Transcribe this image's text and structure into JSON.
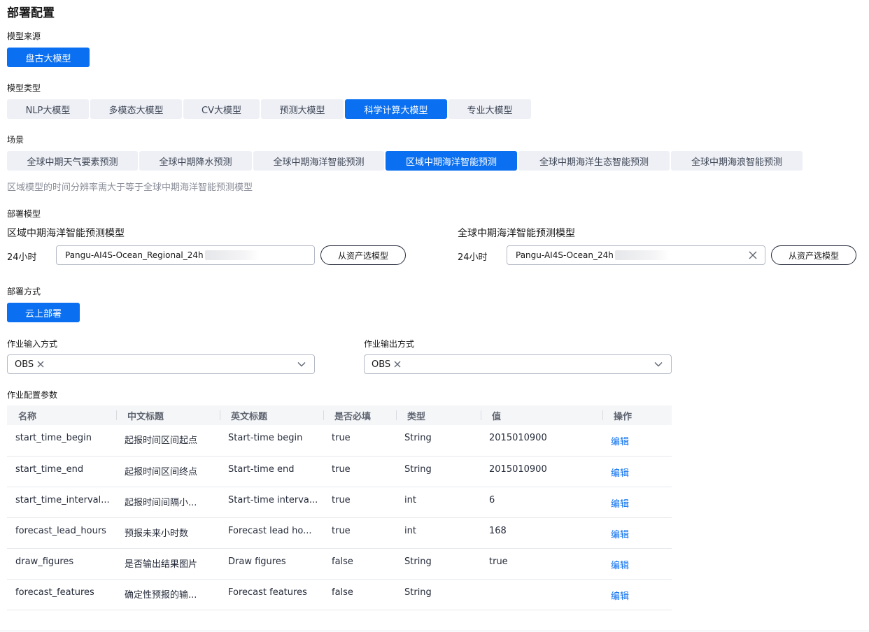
{
  "page_title": "部署配置",
  "model_source": {
    "label": "模型来源",
    "value": "盘古大模型"
  },
  "model_type": {
    "label": "模型类型",
    "tabs": [
      "NLP大模型",
      "多模态大模型",
      "CV大模型",
      "预测大模型",
      "科学计算大模型",
      "专业大模型"
    ],
    "active_index": 4
  },
  "scenario": {
    "label": "场景",
    "tabs": [
      "全球中期天气要素预测",
      "全球中期降水预测",
      "全球中期海洋智能预测",
      "区域中期海洋智能预测",
      "全球中期海洋生态智能预测",
      "全球中期海浪智能预测"
    ],
    "active_index": 3,
    "hint": "区域模型的时间分辨率需大于等于全球中期海洋智能预测模型"
  },
  "deploy_model": {
    "label": "部署模型",
    "regional": {
      "title": "区域中期海洋智能预测模型",
      "duration": "24小时",
      "value": "Pangu-AI4S-Ocean_Regional_24h",
      "button": "从资产选模型"
    },
    "global": {
      "title": "全球中期海洋智能预测模型",
      "duration": "24小时",
      "value": "Pangu-AI4S-Ocean_24h",
      "button": "从资产选模型"
    }
  },
  "deploy_method": {
    "label": "部署方式",
    "value": "云上部署"
  },
  "job_input": {
    "label": "作业输入方式",
    "value": "OBS"
  },
  "job_output": {
    "label": "作业输出方式",
    "value": "OBS"
  },
  "job_params": {
    "label": "作业配置参数",
    "columns": [
      "名称",
      "中文标题",
      "英文标题",
      "是否必填",
      "类型",
      "值",
      "操作"
    ],
    "rows": [
      {
        "name": "start_time_begin",
        "cn": "起报时间区间起点",
        "en": "Start-time begin",
        "required": "true",
        "type": "String",
        "value": "2015010900",
        "action": "编辑"
      },
      {
        "name": "start_time_end",
        "cn": "起报时间区间终点",
        "en": "Start-time end",
        "required": "true",
        "type": "String",
        "value": "2015010900",
        "action": "编辑"
      },
      {
        "name": "start_time_interval...",
        "cn": "起报时间间隔小...",
        "en": "Start-time interva...",
        "required": "true",
        "type": "int",
        "value": "6",
        "action": "编辑"
      },
      {
        "name": "forecast_lead_hours",
        "cn": "预报未来小时数",
        "en": "Forecast lead ho...",
        "required": "true",
        "type": "int",
        "value": "168",
        "action": "编辑"
      },
      {
        "name": "draw_figures",
        "cn": "是否输出结果图片",
        "en": "Draw figures",
        "required": "false",
        "type": "String",
        "value": "true",
        "action": "编辑"
      },
      {
        "name": "forecast_features",
        "cn": "确定性预报的输...",
        "en": "Forecast features",
        "required": "false",
        "type": "String",
        "value": "",
        "action": "编辑"
      }
    ]
  },
  "colors": {
    "accent": "#0a6ff0",
    "tab_bg": "#eef0f5",
    "header_bg": "#f5f6f8"
  }
}
